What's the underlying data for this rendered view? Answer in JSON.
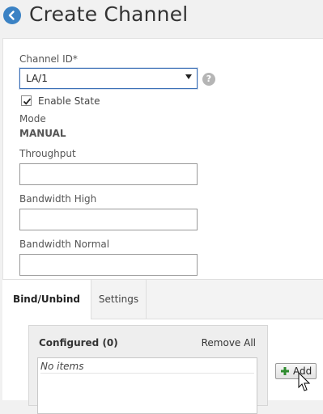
{
  "header": {
    "title": "Create Channel",
    "back_icon": "back-arrow-icon",
    "accent_color": "#3b82c4"
  },
  "form": {
    "channel_id": {
      "label": "Channel ID*",
      "selected": "LA/1",
      "help_icon": "help-icon"
    },
    "enable_state": {
      "label": "Enable State",
      "checked": true
    },
    "mode": {
      "label": "Mode",
      "value": "MANUAL"
    },
    "throughput": {
      "label": "Throughput",
      "value": ""
    },
    "bandwidth_high": {
      "label": "Bandwidth High",
      "value": ""
    },
    "bandwidth_normal": {
      "label": "Bandwidth Normal",
      "value": ""
    }
  },
  "tabs": [
    {
      "label": "Bind/Unbind",
      "active": true
    },
    {
      "label": "Settings",
      "active": false
    }
  ],
  "configured": {
    "title": "Configured (0)",
    "remove_all": "Remove All",
    "empty_text": "No items"
  },
  "add_button": {
    "label": "Add",
    "icon": "plus-icon"
  }
}
